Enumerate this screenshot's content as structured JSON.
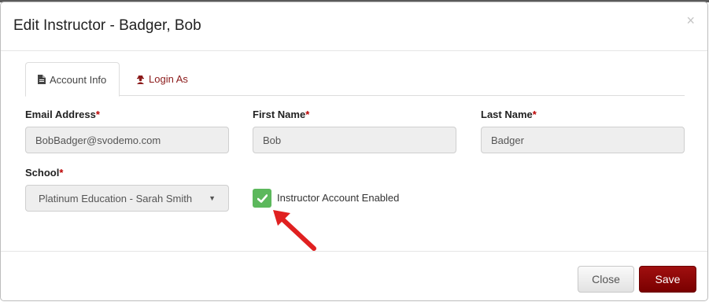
{
  "modal": {
    "title": "Edit Instructor - Badger, Bob",
    "close_symbol": "×"
  },
  "tabs": [
    {
      "label": "Account Info",
      "icon": "document-icon",
      "active": true
    },
    {
      "label": "Login As",
      "icon": "user-secret-icon",
      "active": false
    }
  ],
  "form": {
    "email": {
      "label": "Email Address",
      "required_mark": "*",
      "value": "BobBadger@svodemo.com"
    },
    "first_name": {
      "label": "First Name",
      "required_mark": "*",
      "value": "Bob"
    },
    "last_name": {
      "label": "Last Name",
      "required_mark": "*",
      "value": "Badger"
    },
    "school": {
      "label": "School",
      "required_mark": "*",
      "value": "Platinum Education - Sarah Smith"
    },
    "enabled": {
      "label": "Instructor Account Enabled",
      "checked": true
    }
  },
  "footer": {
    "close_label": "Close",
    "save_label": "Save"
  },
  "colors": {
    "accent": "#8b1a1a",
    "checkbox": "#5cb85c",
    "annotation_arrow": "#e02020"
  }
}
